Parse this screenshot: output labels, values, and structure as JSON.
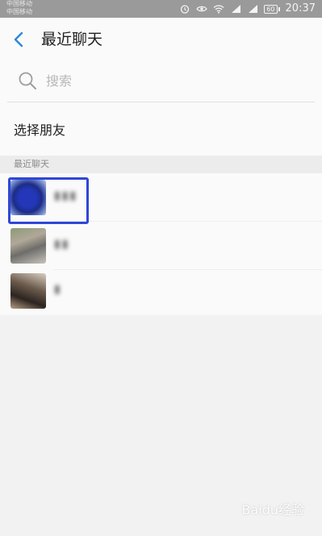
{
  "status_bar": {
    "carrier_1": "中国移动",
    "carrier_2": "中国移动",
    "battery": "60",
    "time": "20:37"
  },
  "header": {
    "title": "最近聊天"
  },
  "search": {
    "placeholder": "搜索"
  },
  "select_friends": {
    "label": "选择朋友"
  },
  "recent_section": {
    "label": "最近聊天"
  },
  "chats": [
    {
      "name": "▮▮▮",
      "avatar_style": "blue-pattern"
    },
    {
      "name": "▮▮",
      "avatar_style": "green-photo"
    },
    {
      "name": "▮",
      "avatar_style": "brown-photo"
    }
  ],
  "highlight_color": "#2f46d8",
  "watermark": "Baidu经验"
}
